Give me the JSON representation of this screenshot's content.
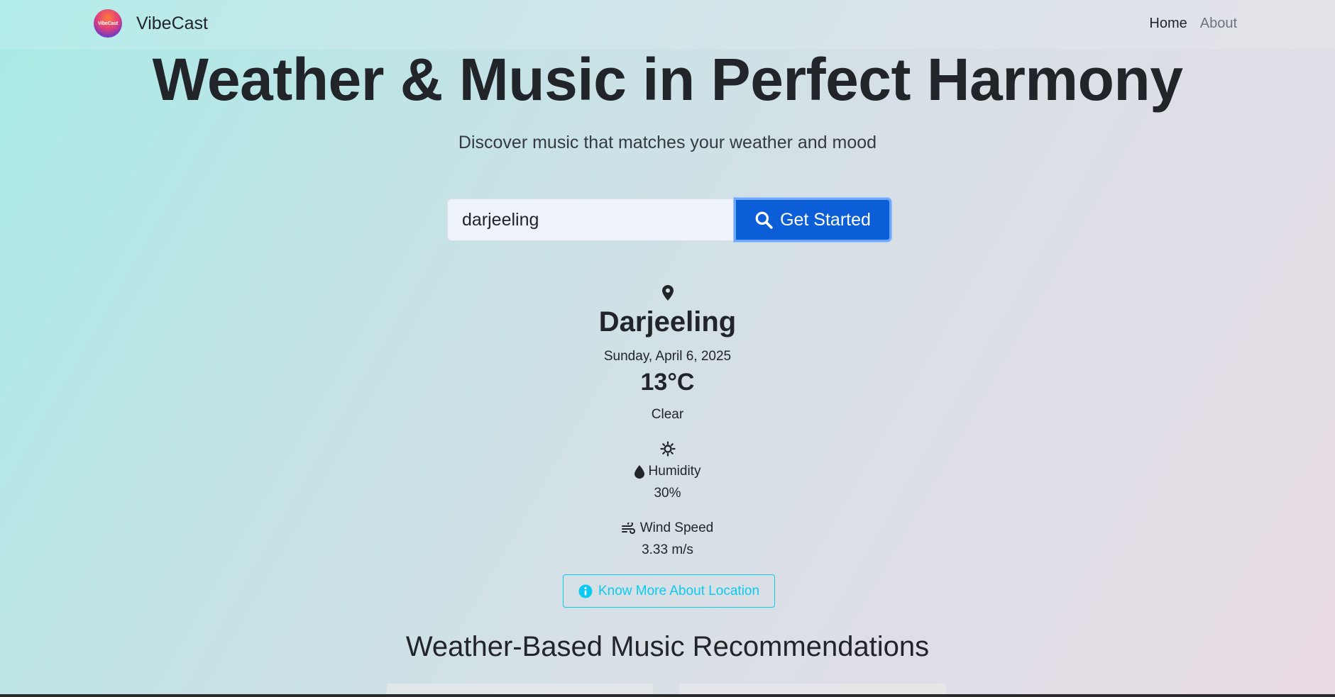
{
  "nav": {
    "logo_text": "VibeCast",
    "brand": "VibeCast",
    "links": [
      {
        "label": "Home"
      },
      {
        "label": "About"
      }
    ]
  },
  "hero": {
    "title": "Weather & Music in Perfect Harmony",
    "subtitle": "Discover music that matches your weather and mood"
  },
  "search": {
    "value": "darjeeling",
    "button_label": "Get Started",
    "icon": "search-icon"
  },
  "weather": {
    "city": "Darjeeling",
    "date": "Sunday, April 6, 2025",
    "temperature": "13°C",
    "condition": "Clear",
    "humidity_label": "Humidity",
    "humidity_value": "30%",
    "wind_label": "Wind Speed",
    "wind_value": "3.33 m/s",
    "info_button": "Know More About Location"
  },
  "recommendations": {
    "title": "Weather-Based Music Recommendations"
  },
  "colors": {
    "primary": "#0b5ed7",
    "info": "#0dcaf0",
    "text": "#212529"
  }
}
